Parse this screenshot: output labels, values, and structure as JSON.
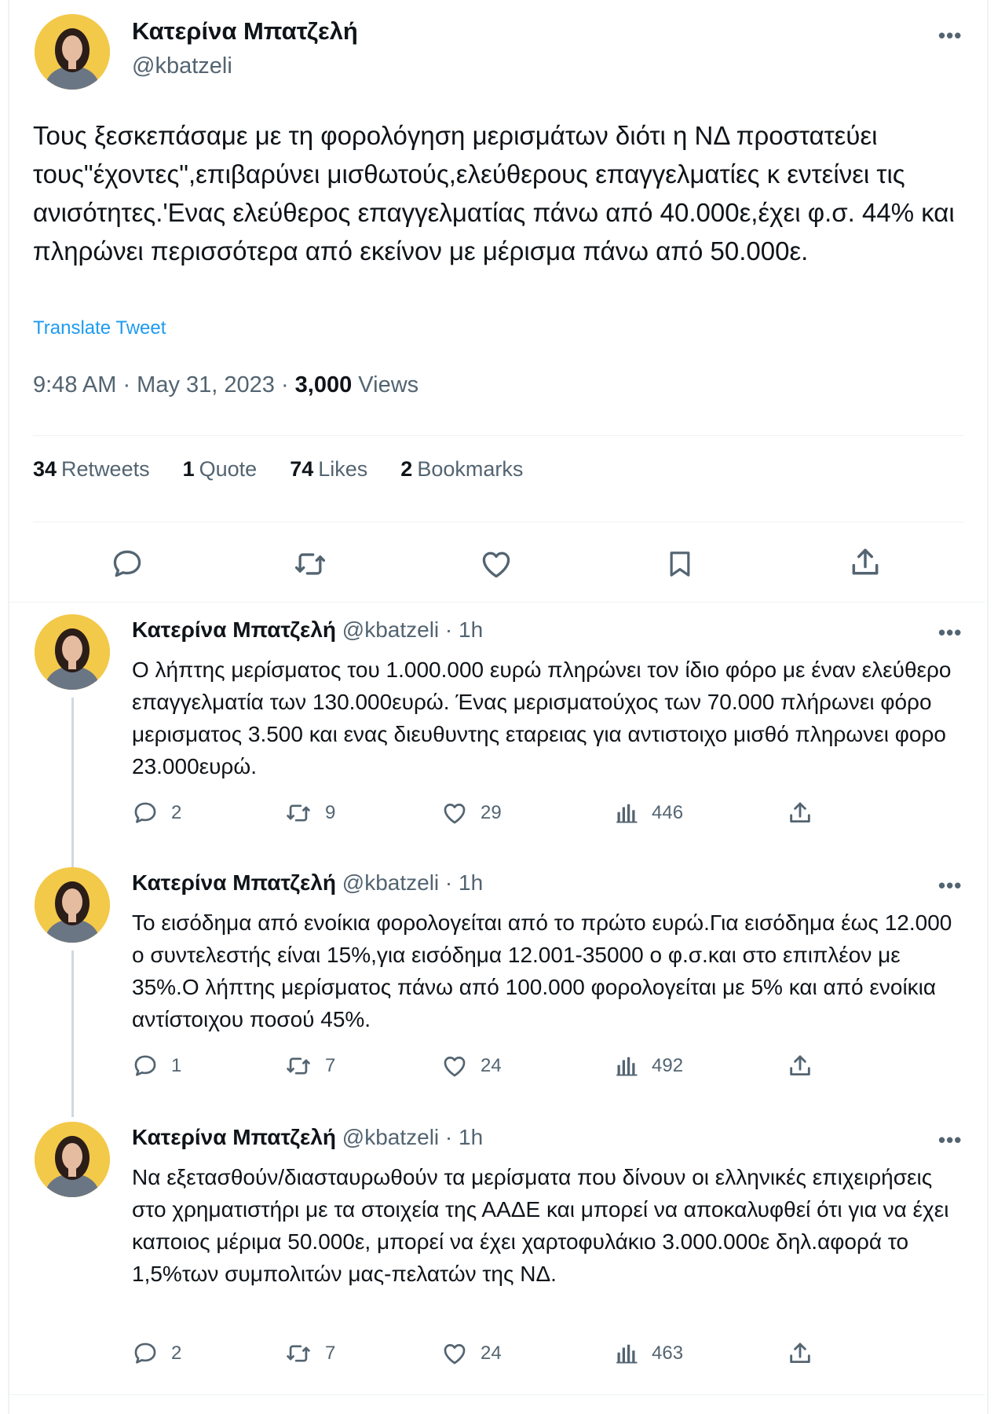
{
  "main_tweet": {
    "author_name": "Κατερίνα Μπατζελή",
    "author_handle": "@kbatzeli",
    "more_label": "•••",
    "text": "Τους ξεσκεπάσαμε με τη φορολόγηση μερισμάτων διότι  η ΝΔ προστατεύει τους\"έχοντες\",επιβαρύνει μισθωτούς,ελεύθερους επαγγελματίες κ εντείνει τις ανισότητες.'Ενας ελεύθερος επαγγελματίας πάνω από 40.000ε,έχει φ.σ. 44% και πληρώνει περισσότερα από εκείνον με μέρισμα πάνω από 50.000ε.",
    "translate_label": "Translate Tweet",
    "time": "9:48 AM · May 31, 2023 · ",
    "views_count": "3,000",
    "views_label": " Views",
    "stats": {
      "retweets_count": "34",
      "retweets_label": "Retweets",
      "quotes_count": "1",
      "quotes_label": "Quote",
      "likes_count": "74",
      "likes_label": "Likes",
      "bookmarks_count": "2",
      "bookmarks_label": "Bookmarks"
    }
  },
  "replies": [
    {
      "author_name": "Κατερίνα Μπατζελή",
      "meta": " @kbatzeli · 1h",
      "more_label": "•••",
      "text": "Ο λήπτης μερίσματος του 1.000.000 ευρώ πληρώνει τον ίδιο φόρο με έναν ελεύθερο επαγγελματία των 130.000ευρώ. Ένας μερισματούχος των 70.000 πλήρωνει φόρο μερισματος 3.500 και ενας διευθυντης εταρειας για αντιστοιχο μισθό πληρωνει φορο 23.000ευρώ.",
      "replies": "2",
      "retweets": "9",
      "likes": "29",
      "views": "446"
    },
    {
      "author_name": "Κατερίνα Μπατζελή",
      "meta": " @kbatzeli · 1h",
      "more_label": "•••",
      "text": "Το εισόδημα από ενοίκια φορολογείται από το πρώτο ευρώ.Για εισόδημα έως 12.000 ο συντελεστής είναι 15%,για εισόδημα 12.001-35000 ο φ.σ.και στο επιπλέον με  35%.Ο λήπτης μερίσματος πάνω από 100.000 φορολογείται με 5% και από ενοίκια αντίστοιχου ποσού 45%.",
      "replies": "1",
      "retweets": "7",
      "likes": "24",
      "views": "492"
    },
    {
      "author_name": "Κατερίνα Μπατζελή",
      "meta": " @kbatzeli · 1h",
      "more_label": "•••",
      "text": "Να εξετασθούν/διασταυρωθούν τα μερίσματα που δίνουν οι ελληνικές επιχειρήσεις στο χρηματιστήρι με τα στοιχεία της ΑΑΔΕ και μπορεί να αποκαλυφθεί ότι για  να έχει καποιος μέριμα 50.000ε, μπορεί να έχει χαρτοφυλάκιο 3.000.000ε δηλ.αφορά το 1,5%των συμπολιτών μας-πελατών της ΝΔ.",
      "replies": "2",
      "retweets": "7",
      "likes": "24",
      "views": "463"
    }
  ],
  "colors": {
    "text": "#0f1419",
    "secondary": "#536471",
    "link": "#1d9bf0",
    "divider": "#eff3f4"
  }
}
